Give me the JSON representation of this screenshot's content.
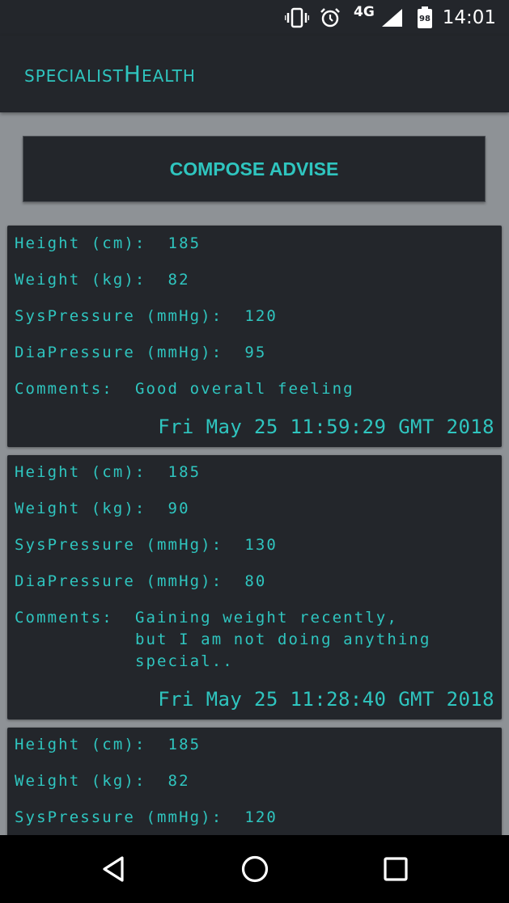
{
  "status_bar": {
    "time": "14:01",
    "network": "4G",
    "battery": "98",
    "icons": [
      "vibrate-icon",
      "alarm-icon",
      "signal-icon",
      "battery-icon"
    ]
  },
  "app_bar": {
    "title": "specialistHealth"
  },
  "compose_button": {
    "label": "COMPOSE ADVISE"
  },
  "records": [
    {
      "height_label": "Height (cm):  ",
      "height": "185",
      "weight_label": "Weight (kg):  ",
      "weight": "82",
      "sys_label": "SysPressure (mmHg):  ",
      "sys": "120",
      "dia_label": "DiaPressure (mmHg):  ",
      "dia": "95",
      "comments_label": "Comments:  ",
      "comments": "Good overall feeling",
      "timestamp": "Fri May 25 11:59:29 GMT 2018"
    },
    {
      "height_label": "Height (cm):  ",
      "height": "185",
      "weight_label": "Weight (kg):  ",
      "weight": "90",
      "sys_label": "SysPressure (mmHg):  ",
      "sys": "130",
      "dia_label": "DiaPressure (mmHg):  ",
      "dia": "80",
      "comments_label": "Comments:  ",
      "comments": "Gaining weight recently,\nbut I am not doing anything\nspecial..",
      "timestamp": "Fri May 25 11:28:40 GMT 2018"
    },
    {
      "height_label": "Height (cm):  ",
      "height": "185",
      "weight_label": "Weight (kg):  ",
      "weight": "82",
      "sys_label": "SysPressure (mmHg):  ",
      "sys": "120"
    }
  ]
}
